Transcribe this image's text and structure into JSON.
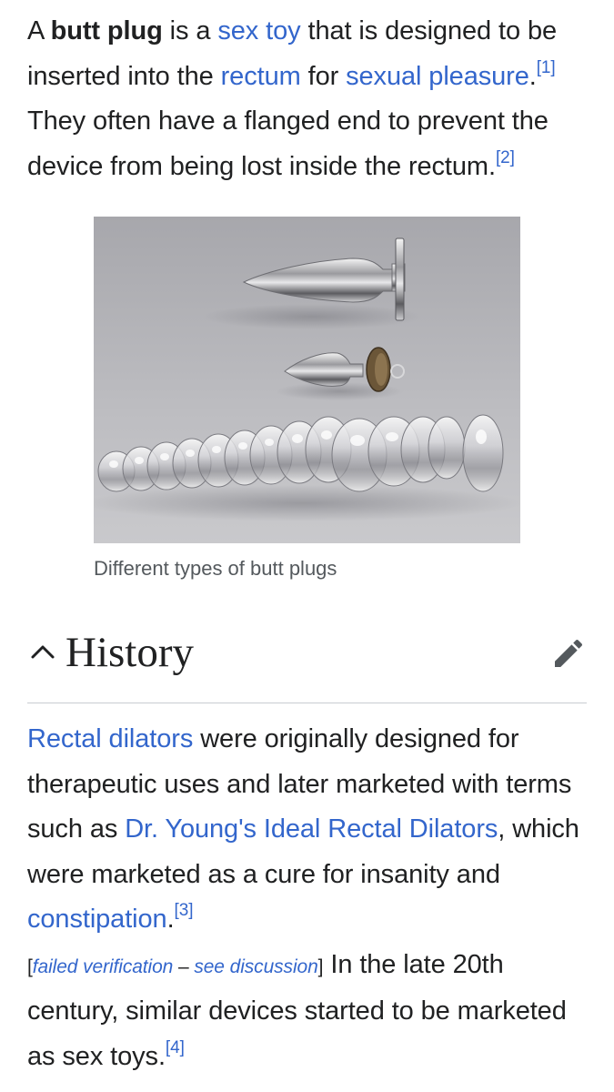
{
  "intro": {
    "t1": "A ",
    "bold": "butt plug",
    "t2": " is a ",
    "link_sex_toy": "sex toy",
    "t3": " that is designed to be inserted into the ",
    "link_rectum": "rectum",
    "t4": " for ",
    "link_sexual_pleasure": "sexual pleasure",
    "t5": ".",
    "ref1": "[1]",
    "t6": " They often have a flanged end to prevent the device from being lost inside the rectum.",
    "ref2": "[2]"
  },
  "figure": {
    "caption": "Different types of butt plugs"
  },
  "section": {
    "title": "History"
  },
  "history": {
    "link_rectal_dilators": "Rectal dilators",
    "t1": " were originally designed for therapeutic uses and later marketed with terms such as ",
    "link_dr_young": "Dr. Young's Ideal Rectal Dilators",
    "t2": ", which were marketed as a cure for insanity and ",
    "link_constipation": "constipation",
    "t3": ".",
    "ref3": "[3]",
    "failed_open": "[",
    "failed_text": "failed verification",
    "failed_dash": " – ",
    "see_discussion": "see discussion",
    "failed_close": "]",
    "t4": " In the late 20th century, similar devices started to be marketed as sex toys.",
    "ref4": "[4]"
  },
  "colors": {
    "link": "#3366cc",
    "text": "#202122",
    "caption": "#54595d",
    "divider": "#c8ccd1",
    "icon": "#54595d"
  },
  "icons": {
    "collapse": "chevron-up-icon",
    "edit": "pencil-icon"
  }
}
